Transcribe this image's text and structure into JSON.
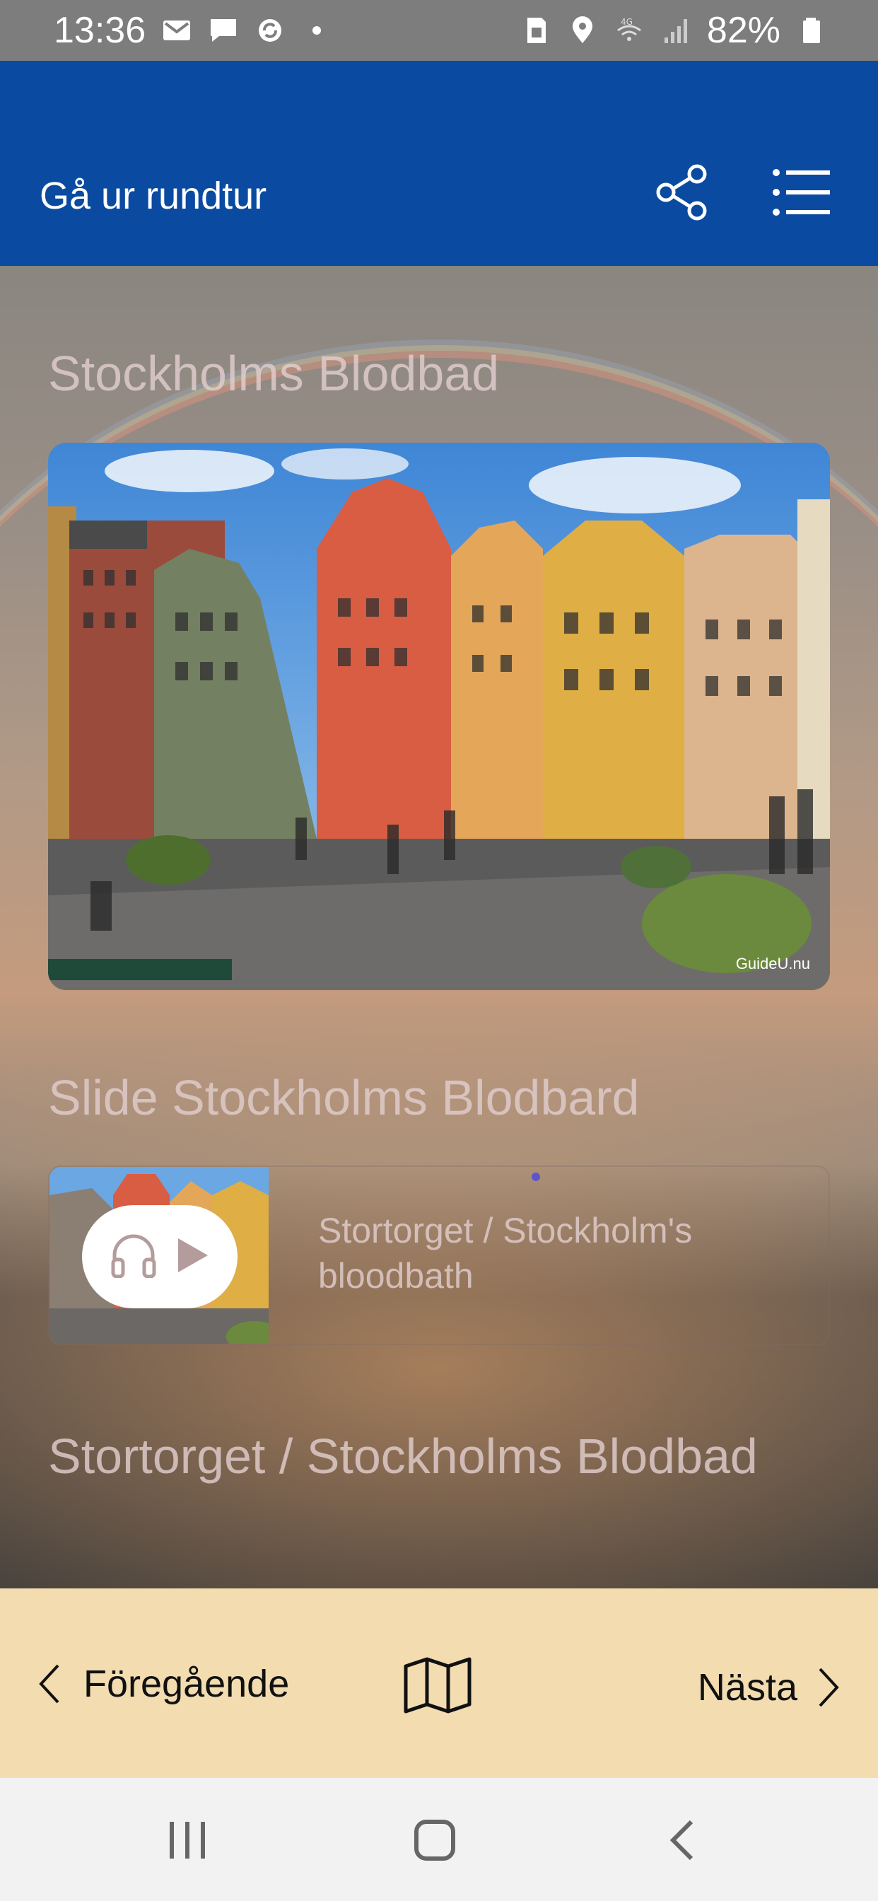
{
  "status_bar": {
    "time": "13:36",
    "battery": "82%",
    "network": "4G",
    "icons": [
      "mail-icon",
      "chat-icon",
      "sync-icon",
      "dot-icon",
      "sim-icon",
      "location-icon",
      "wifi-4g-icon",
      "signal-icon",
      "battery-icon"
    ]
  },
  "app_bar": {
    "title": "Gå ur rundtur",
    "icons": [
      "share-icon",
      "list-menu-icon"
    ],
    "color": "#0a4aa1"
  },
  "main": {
    "heading1": "Stockholms Blodbad",
    "hero_image": {
      "watermark": "GuideU.nu"
    },
    "heading2": "Slide Stockholms Blodbard",
    "slide_card": {
      "text": "Stortorget / Stockholm's bloodbath",
      "icons": [
        "headphones-icon",
        "play-icon"
      ]
    },
    "heading3": "Stortorget / Stockholms Blodbad"
  },
  "bottom_nav": {
    "prev_label": "Föregående",
    "next_label": "Nästa",
    "icons": [
      "chevron-left-icon",
      "map-icon",
      "chevron-right-icon"
    ],
    "background": "#f2dcb0"
  },
  "system_nav": {
    "icons": [
      "recent-apps-icon",
      "home-icon",
      "back-icon"
    ]
  }
}
